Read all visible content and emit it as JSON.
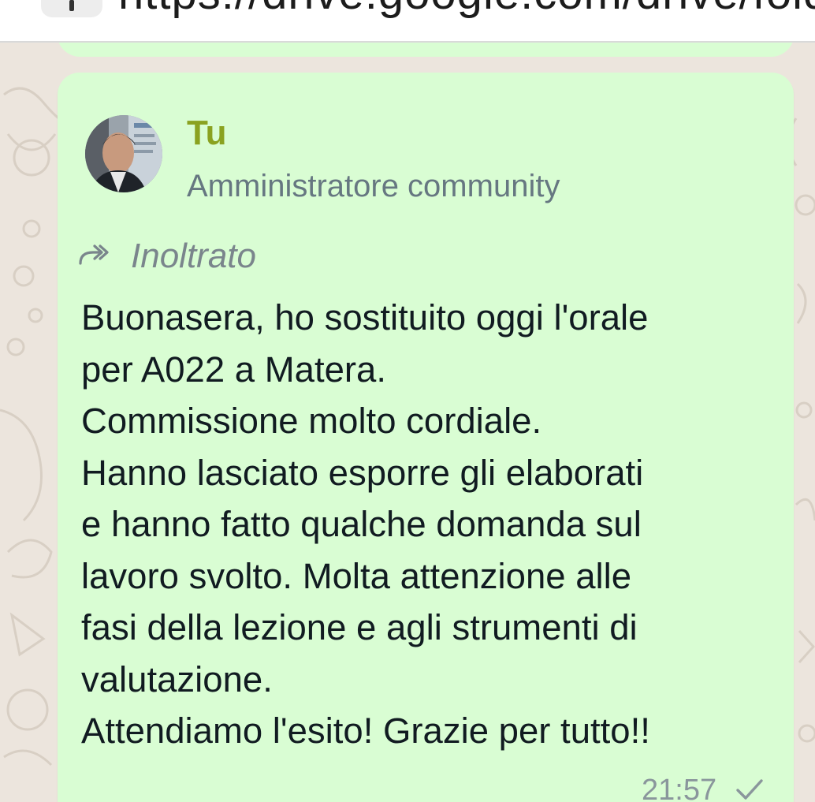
{
  "browser": {
    "url_text": "https://drive.google.com/drive/fold..."
  },
  "message": {
    "sender_name": "Tu",
    "sender_role": "Amministratore community",
    "forwarded_label": "Inoltrato",
    "lines": [
      "Buonasera, ho sostituito oggi l'orale",
      "per A022 a Matera.",
      "Commissione molto cordiale.",
      "Hanno lasciato esporre gli elaborati",
      "e hanno fatto qualche domanda sul",
      "lavoro svolto. Molta attenzione alle",
      "fasi della lezione e agli strumenti di",
      "valutazione.",
      "Attendiamo l'esito! Grazie per tutto!!"
    ],
    "time": "21:57",
    "status_icon": "single-check-icon"
  },
  "colors": {
    "bubble": "#d9fdd3",
    "wallpaper": "#ece5dd",
    "sender_name": "#8aa220",
    "meta_text": "#667781",
    "message_text": "#111b21"
  }
}
